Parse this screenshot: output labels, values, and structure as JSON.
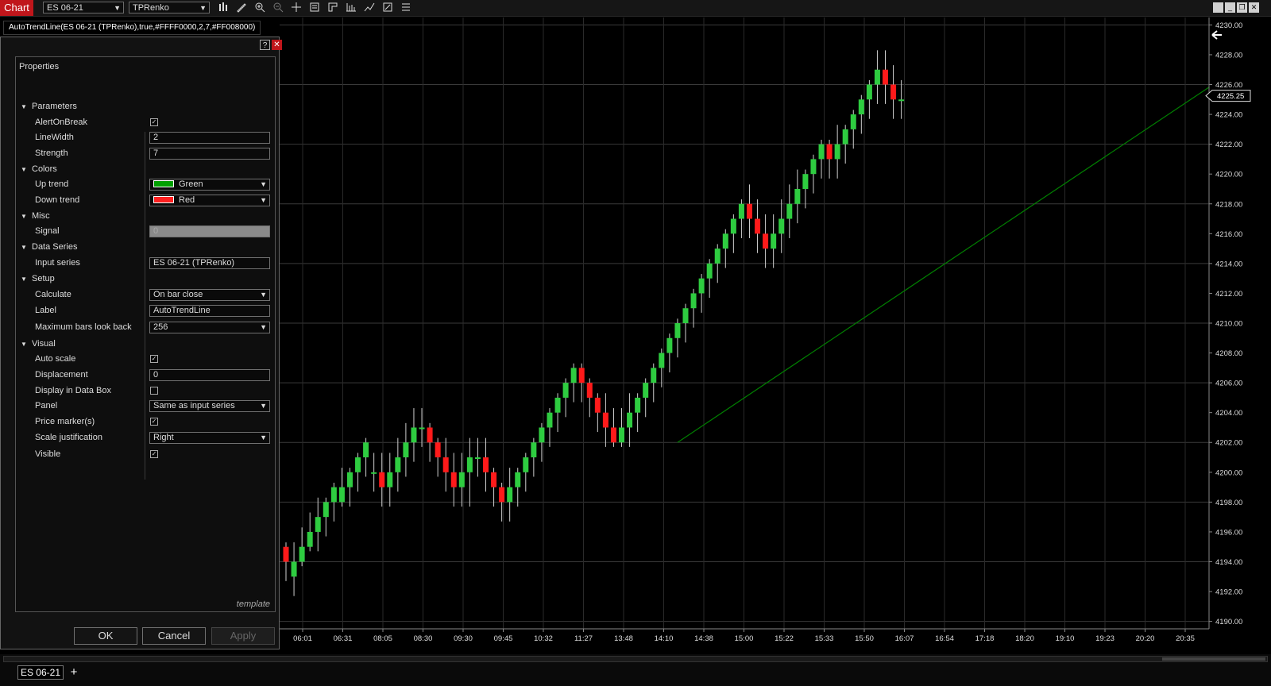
{
  "toolbar": {
    "chart_tab": "Chart",
    "instrument": "ES 06-21",
    "bar_type": "TPRenko",
    "icons": [
      "bars-icon",
      "pencil-icon",
      "zoom-in-icon",
      "zoom-out-icon",
      "crosshair-icon",
      "data-box-icon",
      "strategy-icon",
      "indicator-icon",
      "drawing-tools-icon",
      "properties-icon",
      "list-icon"
    ]
  },
  "indicator_label": "AutoTrendLine(ES 06-21 (TPRenko),true,#FFFF0000,2,7,#FF008000)",
  "properties": {
    "title": "Properties",
    "help_label": "?",
    "close_label": "✕",
    "sections": {
      "parameters": "Parameters",
      "colors": "Colors",
      "misc": "Misc",
      "data_series": "Data Series",
      "setup": "Setup",
      "visual": "Visual"
    },
    "labels": {
      "alert_on_break": "AlertOnBreak",
      "line_width": "LineWidth",
      "strength": "Strength",
      "up_trend": "Up trend",
      "down_trend": "Down trend",
      "signal": "Signal",
      "input_series": "Input series",
      "calculate": "Calculate",
      "label": "Label",
      "max_bars": "Maximum bars look back",
      "auto_scale": "Auto scale",
      "displacement": "Displacement",
      "display_data_box": "Display in Data Box",
      "panel": "Panel",
      "price_markers": "Price marker(s)",
      "scale_justification": "Scale justification",
      "visible": "Visible"
    },
    "values": {
      "alert_on_break": true,
      "line_width": "2",
      "strength": "7",
      "up_trend": "Green",
      "up_trend_color": "#00a000",
      "down_trend": "Red",
      "down_trend_color": "#ff2020",
      "signal": "0",
      "input_series": "ES 06-21 (TPRenko)",
      "calculate": "On bar close",
      "label": "AutoTrendLine",
      "max_bars": "256",
      "auto_scale": true,
      "displacement": "0",
      "display_data_box": false,
      "panel": "Same as input series",
      "price_markers": true,
      "scale_justification": "Right",
      "visible": true
    },
    "template_link": "template",
    "buttons": {
      "ok": "OK",
      "cancel": "Cancel",
      "apply": "Apply"
    }
  },
  "bottom": {
    "series_tab": "ES 06-21",
    "add_tab": "+"
  },
  "chart_data": {
    "type": "candlestick",
    "price_axis": [
      "4230.00",
      "4228.00",
      "4226.00",
      "4224.00",
      "4222.00",
      "4220.00",
      "4218.00",
      "4216.00",
      "4214.00",
      "4212.00",
      "4210.00",
      "4208.00",
      "4206.00",
      "4204.00",
      "4202.00",
      "4200.00",
      "4198.00",
      "4196.00",
      "4194.00",
      "4192.00",
      "4190.00"
    ],
    "ylim": [
      4189.5,
      4230.5
    ],
    "current_price": "4225.25",
    "time_axis": [
      "06:01",
      "06:31",
      "08:05",
      "08:30",
      "09:30",
      "09:45",
      "10:32",
      "11:27",
      "13:48",
      "14:10",
      "14:38",
      "15:00",
      "15:22",
      "15:33",
      "15:50",
      "16:07",
      "16:54",
      "17:18",
      "18:20",
      "19:10",
      "19:23",
      "20:20",
      "20:35"
    ],
    "up_color": "#2ecc40",
    "down_color": "#ff1a1a",
    "trendline_color": "#008000",
    "trendline": {
      "start_bar": 49,
      "start_price": 4202.0,
      "end_bar": 116,
      "end_price": 4226.0
    },
    "bars": [
      [
        4195,
        4194,
        4195,
        4193
      ],
      [
        4193,
        4194,
        4195,
        4192
      ],
      [
        4194,
        4195,
        4196,
        4194
      ],
      [
        4195,
        4196,
        4197,
        4195
      ],
      [
        4196,
        4197,
        4198,
        4195
      ],
      [
        4197,
        4198,
        4198,
        4196
      ],
      [
        4198,
        4199,
        4199,
        4197
      ],
      [
        4198,
        4199,
        4200,
        4198
      ],
      [
        4199,
        4200,
        4200,
        4198
      ],
      [
        4200,
        4201,
        4201,
        4199
      ],
      [
        4201,
        4202,
        4202,
        4200
      ],
      [
        4200,
        4200,
        4201,
        4199
      ],
      [
        4200,
        4199,
        4201,
        4198
      ],
      [
        4199,
        4200,
        4201,
        4198
      ],
      [
        4200,
        4201,
        4202,
        4199
      ],
      [
        4201,
        4202,
        4203,
        4200
      ],
      [
        4202,
        4203,
        4204,
        4201
      ],
      [
        4203,
        4203,
        4204,
        4202
      ],
      [
        4203,
        4202,
        4203,
        4201
      ],
      [
        4202,
        4201,
        4202,
        4200
      ],
      [
        4201,
        4200,
        4202,
        4199
      ],
      [
        4200,
        4199,
        4201,
        4198
      ],
      [
        4199,
        4200,
        4201,
        4198
      ],
      [
        4200,
        4201,
        4202,
        4198
      ],
      [
        4201,
        4201,
        4202,
        4200
      ],
      [
        4201,
        4200,
        4202,
        4199
      ],
      [
        4200,
        4199,
        4200,
        4198
      ],
      [
        4199,
        4198,
        4199,
        4197
      ],
      [
        4198,
        4199,
        4200,
        4197
      ],
      [
        4199,
        4200,
        4200,
        4198
      ],
      [
        4200,
        4201,
        4201,
        4199
      ],
      [
        4201,
        4202,
        4202,
        4200
      ],
      [
        4202,
        4203,
        4203,
        4201
      ],
      [
        4203,
        4204,
        4204,
        4202
      ],
      [
        4204,
        4205,
        4205,
        4203
      ],
      [
        4205,
        4206,
        4206,
        4204
      ],
      [
        4206,
        4207,
        4207,
        4205
      ],
      [
        4207,
        4206,
        4207,
        4205
      ],
      [
        4206,
        4205,
        4206,
        4204
      ],
      [
        4205,
        4204,
        4205,
        4203
      ],
      [
        4204,
        4203,
        4205,
        4202
      ],
      [
        4203,
        4202,
        4204,
        4202
      ],
      [
        4202,
        4203,
        4204,
        4202
      ],
      [
        4203,
        4204,
        4205,
        4202
      ],
      [
        4204,
        4205,
        4205,
        4203
      ],
      [
        4205,
        4206,
        4206,
        4204
      ],
      [
        4206,
        4207,
        4207,
        4205
      ],
      [
        4207,
        4208,
        4208,
        4206
      ],
      [
        4208,
        4209,
        4209,
        4207
      ],
      [
        4209,
        4210,
        4210,
        4208
      ],
      [
        4210,
        4211,
        4211,
        4209
      ],
      [
        4211,
        4212,
        4212,
        4210
      ],
      [
        4212,
        4213,
        4213,
        4211
      ],
      [
        4213,
        4214,
        4214,
        4212
      ],
      [
        4214,
        4215,
        4215,
        4213
      ],
      [
        4215,
        4216,
        4216,
        4214
      ],
      [
        4216,
        4217,
        4217,
        4215
      ],
      [
        4217,
        4218,
        4218,
        4216
      ],
      [
        4218,
        4217,
        4219,
        4216
      ],
      [
        4217,
        4216,
        4218,
        4215
      ],
      [
        4216,
        4215,
        4217,
        4214
      ],
      [
        4215,
        4216,
        4217,
        4214
      ],
      [
        4216,
        4217,
        4218,
        4215
      ],
      [
        4217,
        4218,
        4219,
        4216
      ],
      [
        4218,
        4219,
        4220,
        4217
      ],
      [
        4219,
        4220,
        4220,
        4218
      ],
      [
        4220,
        4221,
        4221,
        4219
      ],
      [
        4221,
        4222,
        4222,
        4220
      ],
      [
        4222,
        4221,
        4222,
        4220
      ],
      [
        4221,
        4222,
        4223,
        4220
      ],
      [
        4222,
        4223,
        4223,
        4221
      ],
      [
        4223,
        4224,
        4224,
        4222
      ],
      [
        4224,
        4225,
        4225,
        4223
      ],
      [
        4225,
        4226,
        4226,
        4224
      ],
      [
        4226,
        4227,
        4228,
        4225
      ],
      [
        4227,
        4226,
        4228,
        4225
      ],
      [
        4226,
        4225,
        4227,
        4224
      ],
      [
        4225,
        4225,
        4226,
        4224
      ]
    ]
  }
}
